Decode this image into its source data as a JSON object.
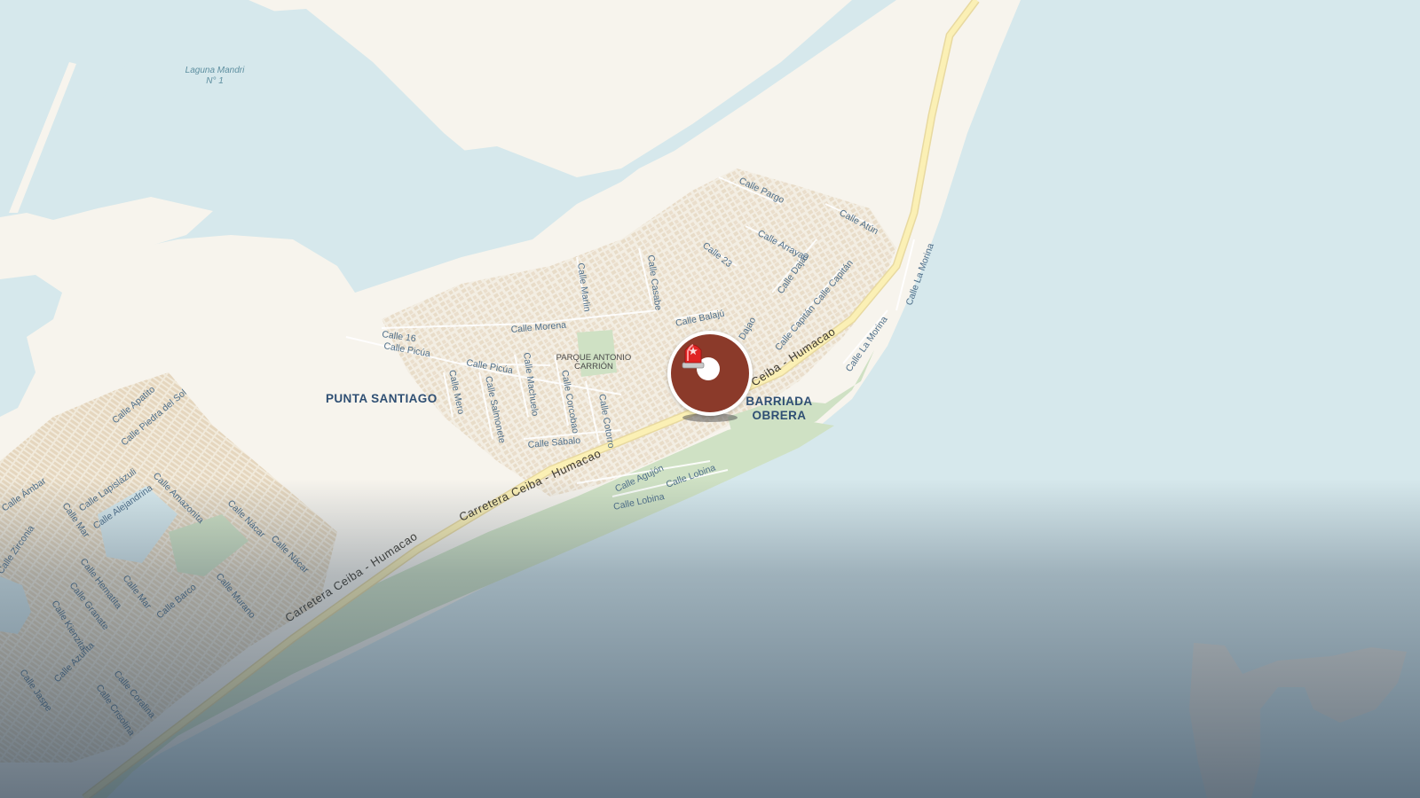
{
  "map": {
    "water_labels": {
      "laguna": "Laguna Mandri\nN° 1"
    },
    "places": {
      "punta_santiago": "PUNTA SANTIAGO",
      "barriada_obrera_1": "BARRIADA",
      "barriada_obrera_2": "OBRERA"
    },
    "parks": {
      "antonio_1": "PARQUE ANTONIO",
      "antonio_2": "CARRIÓN"
    },
    "roads": {
      "carretera_1": "Carretera Ceiba - Humacao",
      "carretera_2": "Carretera Ceiba - Humacao",
      "carretera_3": "Ceiba - Humacao"
    },
    "streets": [
      "Calle Pargo",
      "Calle Atún",
      "Calle Arrayao",
      "Calle 23",
      "Calle Dajao",
      "Calle Capitán",
      "Calle Capitán",
      "Calle La Morina",
      "Calle La Morina",
      "Calle Marlin",
      "Calle Casabe",
      "Calle Balajú",
      "Dajao",
      "Calle Morena",
      "Calle 16",
      "Calle Picúa",
      "Calle Picúa",
      "Calle Mero",
      "Calle Salmonete",
      "Calle Machuelo",
      "Calle Corcobao",
      "Calle Cotorro",
      "Calle Sábalo",
      "Calle Agujón",
      "Calle Lobina",
      "Calle Lobina",
      "Calle Apatito",
      "Calle Piedra del Sol",
      "Calle Ámbar",
      "Calle Lapislázuli",
      "Calle Alejandrina",
      "Calle Amazonita",
      "Calle Mar",
      "Calle Nácar",
      "Calle Nácar",
      "Calle Zirconia",
      "Calle Hematita",
      "Calle Granate",
      "Calle Mar",
      "Calle Barco",
      "Calle Murano",
      "Calle Kienzita",
      "Calle Azurita",
      "Calle Jaspe",
      "Calle Coralina",
      "Calle Crisolina"
    ],
    "marker": {
      "icon": "siren-icon",
      "color": "#8b3a2a"
    }
  },
  "colors": {
    "water": "#d6e8ec",
    "land": "#f7f4ed",
    "park": "#cfe1c4",
    "road_major": "#f8e9a6"
  }
}
